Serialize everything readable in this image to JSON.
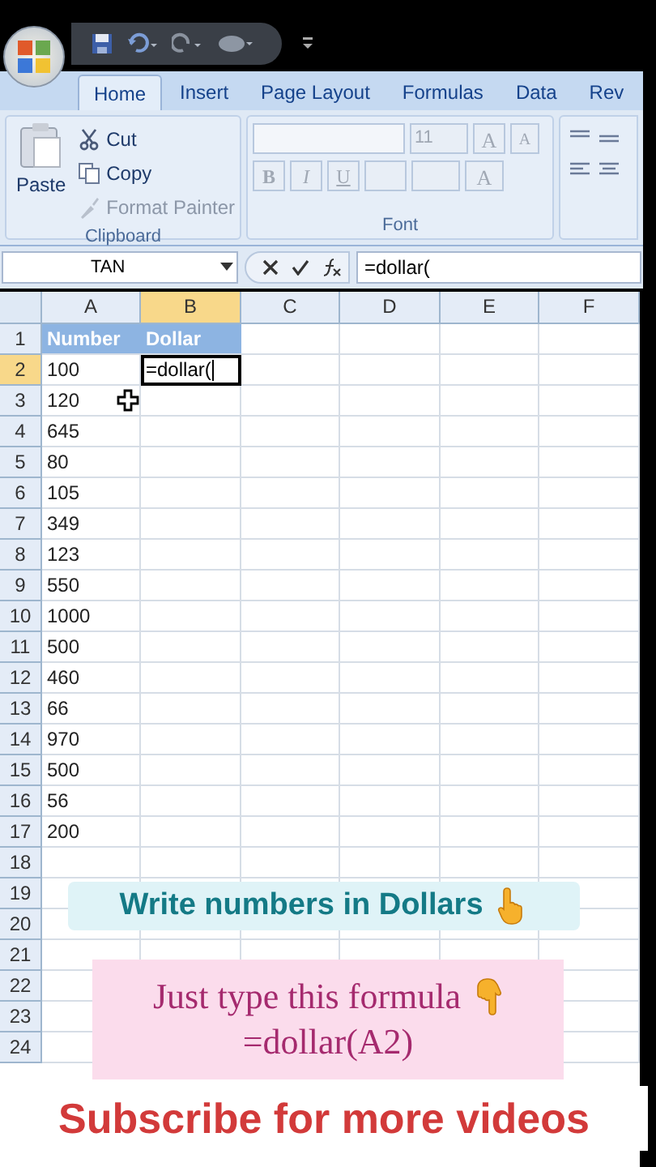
{
  "tabs": [
    {
      "label": "Home",
      "selected": true
    },
    {
      "label": "Insert",
      "selected": false
    },
    {
      "label": "Page Layout",
      "selected": false
    },
    {
      "label": "Formulas",
      "selected": false
    },
    {
      "label": "Data",
      "selected": false
    },
    {
      "label": "Rev",
      "selected": false
    }
  ],
  "clipboard": {
    "paste": "Paste",
    "items": [
      {
        "label": "Cut",
        "disabled": false
      },
      {
        "label": "Copy",
        "disabled": false
      },
      {
        "label": "Format Painter",
        "disabled": true
      }
    ],
    "group_label": "Clipboard"
  },
  "font": {
    "font_size": "11",
    "grow_font": "A",
    "shrink_font": "A",
    "format_buttons": [
      "B",
      "I",
      "U"
    ],
    "font_color": "A",
    "disabled": true,
    "group_label": "Font"
  },
  "formula_bar": {
    "name_box": "TAN",
    "formula": "=dollar("
  },
  "sheet": {
    "columns": [
      {
        "label": "A",
        "selected": false
      },
      {
        "label": "B",
        "selected": true
      },
      {
        "label": "C",
        "selected": false
      },
      {
        "label": "D",
        "selected": false
      },
      {
        "label": "E",
        "selected": false
      },
      {
        "label": "F",
        "selected": false
      }
    ],
    "rows": [
      {
        "label": "1",
        "selected": false,
        "cells": [
          {
            "kind": "header",
            "text": "Number"
          },
          {
            "kind": "header",
            "text": "Dollar"
          }
        ]
      },
      {
        "label": "2",
        "selected": true,
        "cells": [
          {
            "kind": "value",
            "text": "100"
          },
          {
            "kind": "editing",
            "text": "=dollar("
          }
        ]
      },
      {
        "label": "3",
        "selected": false,
        "cells": [
          {
            "kind": "value",
            "text": "120"
          }
        ]
      },
      {
        "label": "4",
        "selected": false,
        "cells": [
          {
            "kind": "value",
            "text": "645"
          }
        ]
      },
      {
        "label": "5",
        "selected": false,
        "cells": [
          {
            "kind": "value",
            "text": "80"
          }
        ]
      },
      {
        "label": "6",
        "selected": false,
        "cells": [
          {
            "kind": "value",
            "text": "105"
          }
        ]
      },
      {
        "label": "7",
        "selected": false,
        "cells": [
          {
            "kind": "value",
            "text": "349"
          }
        ]
      },
      {
        "label": "8",
        "selected": false,
        "cells": [
          {
            "kind": "value",
            "text": "123"
          }
        ]
      },
      {
        "label": "9",
        "selected": false,
        "cells": [
          {
            "kind": "value",
            "text": "550"
          }
        ]
      },
      {
        "label": "10",
        "selected": false,
        "cells": [
          {
            "kind": "value",
            "text": "1000"
          }
        ]
      },
      {
        "label": "11",
        "selected": false,
        "cells": [
          {
            "kind": "value",
            "text": "500"
          }
        ]
      },
      {
        "label": "12",
        "selected": false,
        "cells": [
          {
            "kind": "value",
            "text": "460"
          }
        ]
      },
      {
        "label": "13",
        "selected": false,
        "cells": [
          {
            "kind": "value",
            "text": "66"
          }
        ]
      },
      {
        "label": "14",
        "selected": false,
        "cells": [
          {
            "kind": "value",
            "text": "970"
          }
        ]
      },
      {
        "label": "15",
        "selected": false,
        "cells": [
          {
            "kind": "value",
            "text": "500"
          }
        ]
      },
      {
        "label": "16",
        "selected": false,
        "cells": [
          {
            "kind": "value",
            "text": "56"
          }
        ]
      },
      {
        "label": "17",
        "selected": false,
        "cells": [
          {
            "kind": "value",
            "text": "200"
          }
        ]
      },
      {
        "label": "18",
        "selected": false,
        "cells": []
      },
      {
        "label": "19",
        "selected": false,
        "cells": []
      },
      {
        "label": "20",
        "selected": false,
        "cells": []
      },
      {
        "label": "21",
        "selected": false,
        "cells": []
      },
      {
        "label": "22",
        "selected": false,
        "cells": []
      },
      {
        "label": "23",
        "selected": false,
        "cells": []
      },
      {
        "label": "24",
        "selected": false,
        "cells": []
      }
    ]
  },
  "captions": [
    {
      "kind": "banner",
      "lines": [
        "Write numbers in Dollars"
      ]
    },
    {
      "kind": "note",
      "lines": [
        "Just type this formula",
        "=dollar(A2)"
      ]
    }
  ],
  "subscribe": "Subscribe for more videos"
}
